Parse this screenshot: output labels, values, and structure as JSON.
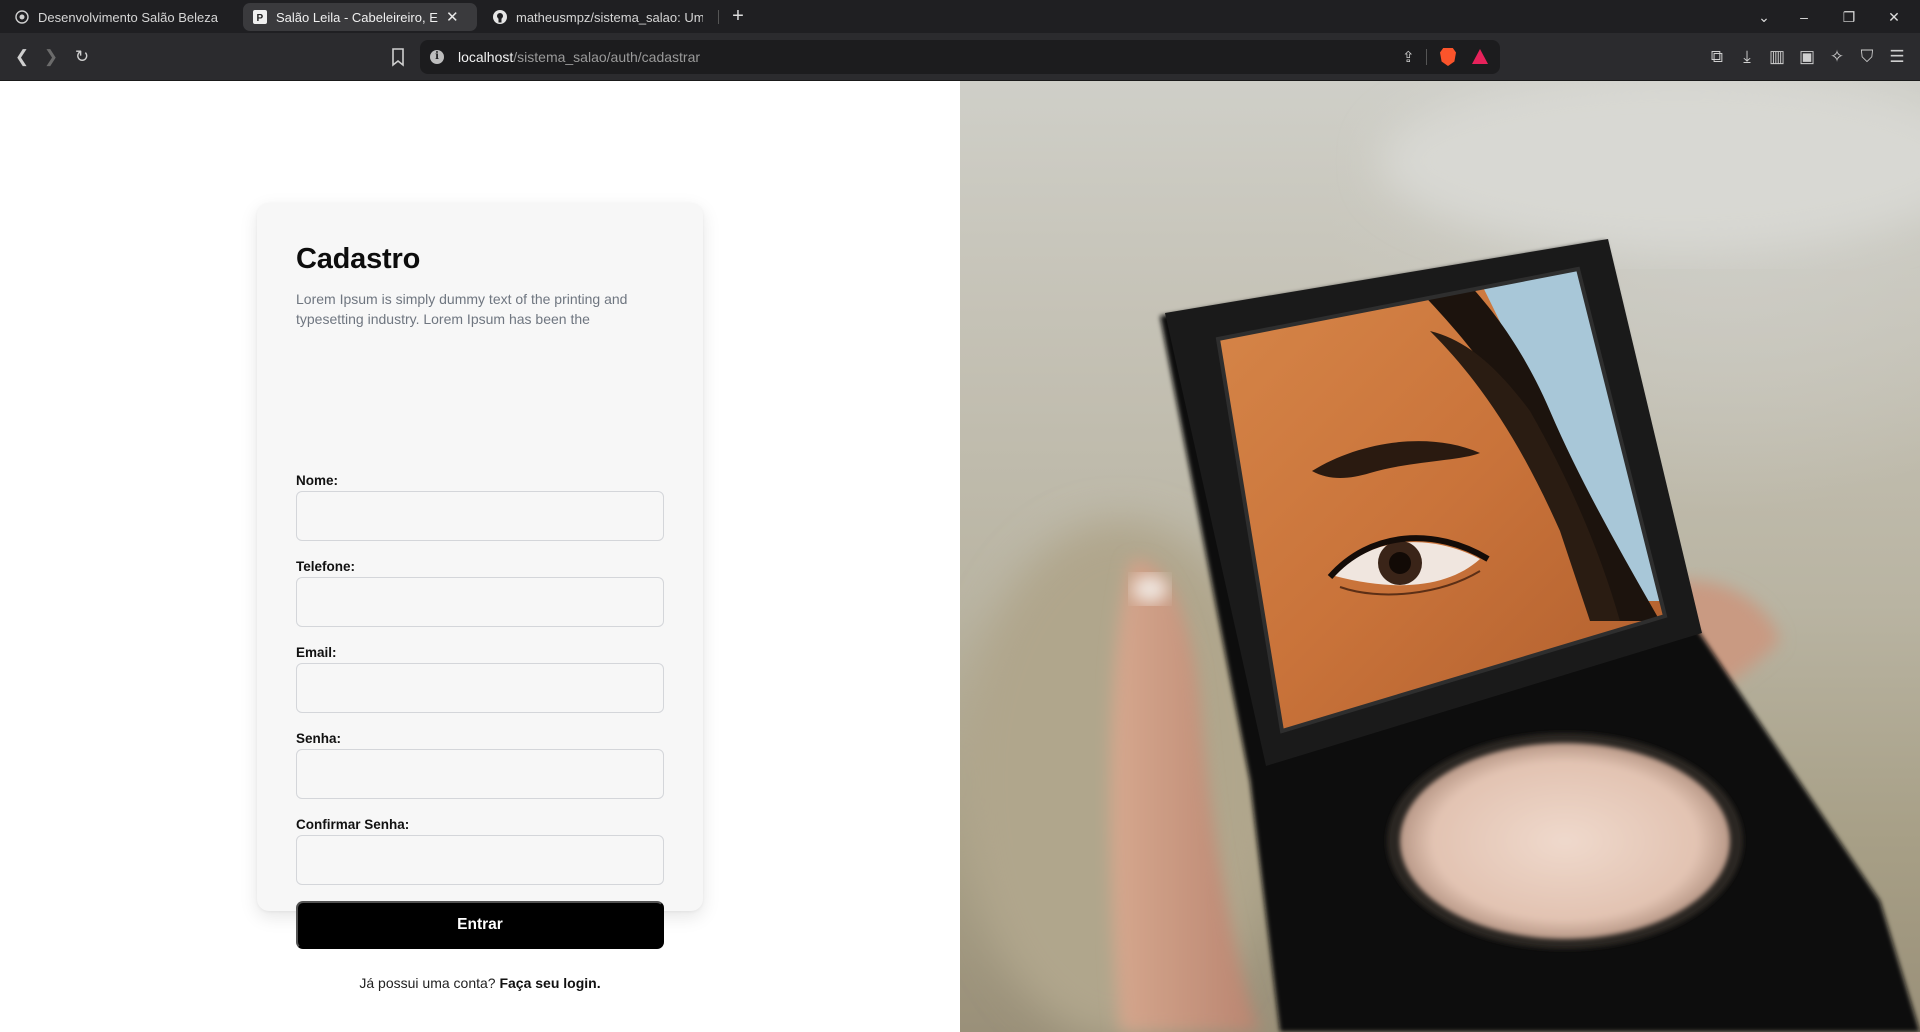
{
  "browser": {
    "tabs": [
      {
        "title": "Desenvolvimento Salão Beleza",
        "icon": "web-icon",
        "active": false
      },
      {
        "title": "Salão Leila - Cabeleireiro, Estét",
        "icon": "page-icon",
        "active": true
      },
      {
        "title": "matheusmpz/sistema_salao: Um sist",
        "icon": "github-icon",
        "active": false
      }
    ],
    "url_host": "localhost",
    "url_path": "/sistema_salao/auth/cadastrar"
  },
  "form": {
    "title": "Cadastro",
    "description": "Lorem Ipsum is simply dummy text of the printing and typesetting industry. Lorem Ipsum has been the",
    "fields": [
      {
        "label": "Nome:",
        "value": ""
      },
      {
        "label": "Telefone:",
        "value": ""
      },
      {
        "label": "Email:",
        "value": ""
      },
      {
        "label": "Senha:",
        "value": ""
      },
      {
        "label": "Confirmar Senha:",
        "value": ""
      }
    ],
    "submit_label": "Entrar",
    "login_prompt": "Já possui uma conta?",
    "login_link": "Faça seu login."
  },
  "colors": {
    "button_bg": "#000000",
    "card_bg": "#f7f7f7",
    "tabbar_bg": "#1f1f22"
  }
}
